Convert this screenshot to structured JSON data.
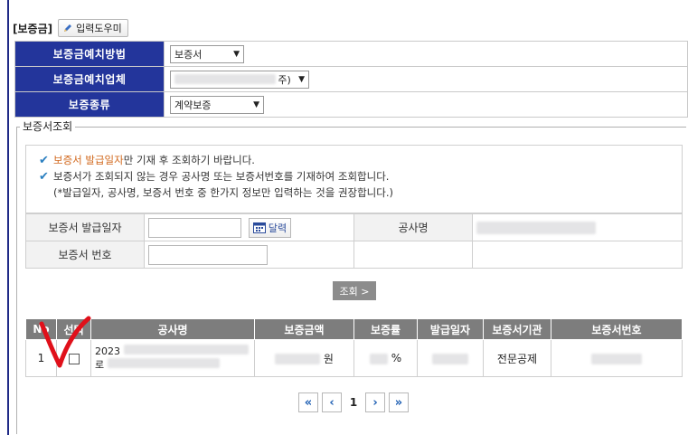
{
  "header": {
    "title": "[보증금]",
    "helper_button": "입력도우미"
  },
  "form": {
    "method_label": "보증금예치방법",
    "method_value": "보증서",
    "company_label": "보증금예치업체",
    "company_value_suffix": "주)",
    "type_label": "보증종류",
    "type_value": "계약보증"
  },
  "lookup": {
    "legend": "보증서조회",
    "notice": {
      "line1_highlight": "보증서 발급일자",
      "line1_rest": "만 기재 후 조회하기 바랍니다.",
      "line2": "보증서가 조회되지 않는 경우 공사명 또는 보증서번호를 기재하여 조회합니다.",
      "line3": "(*발급일자, 공사명, 보증서 번호 중 한가지 정보만 입력하는 것을 권장합니다.)"
    },
    "issue_date_label": "보증서 발급일자",
    "calendar_button": "달력",
    "project_name_label": "공사명",
    "bond_number_label": "보증서 번호",
    "search_button": "조회 >"
  },
  "results": {
    "columns": [
      "No",
      "선택",
      "공사명",
      "보증금액",
      "보증률",
      "발급일자",
      "보증서기관",
      "보증서번호"
    ],
    "rows": [
      {
        "no": "1",
        "project_prefix_1": "2023",
        "project_prefix_2": "로",
        "amount_unit": "원",
        "rate_unit": "%",
        "institution": "전문공제"
      }
    ]
  },
  "pagination": {
    "first": "«",
    "prev": "‹",
    "current": "1",
    "next": "›",
    "last": "»"
  },
  "colors": {
    "label_bg": "#23359b",
    "header_bg": "#7d7d7d",
    "accent_orange": "#d2691e",
    "check_blue": "#2a7fc0",
    "annotation_red": "#e0101a"
  }
}
